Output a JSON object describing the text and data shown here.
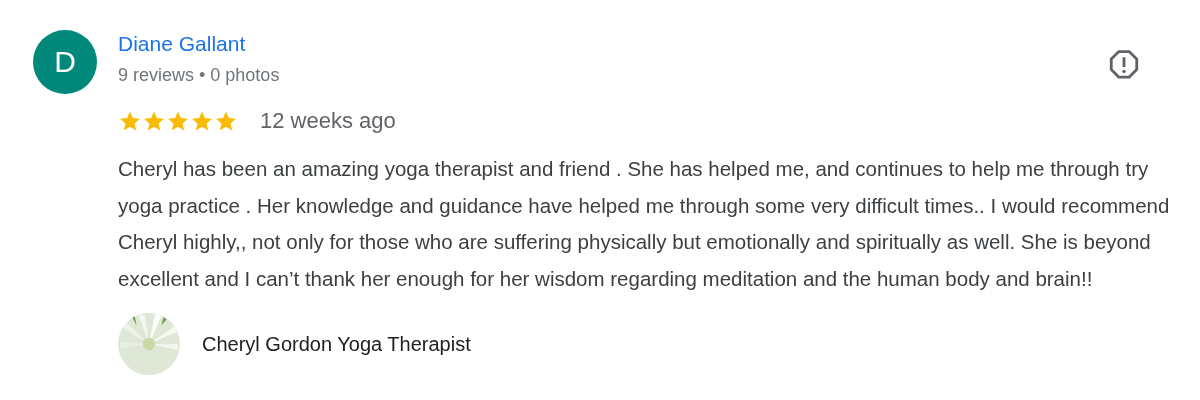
{
  "review": {
    "avatar_letter": "D",
    "author": "Diane Gallant",
    "meta": "9 reviews • 0 photos",
    "stars": 5,
    "time": "12 weeks ago",
    "text": "Cheryl has been an amazing yoga therapist and friend . She has helped me, and continues to help me through try yoga practice . Her knowledge and guidance have helped me through some very difficult times.. I would recommend Cheryl highly,, not only for those who are suffering physically but emotionally and spiritually as well. She is beyond excellent and I can’t thank her enough for her wisdom regarding meditation and the human body and brain!!"
  },
  "reply": {
    "author": "Cheryl Gordon Yoga Therapist"
  }
}
